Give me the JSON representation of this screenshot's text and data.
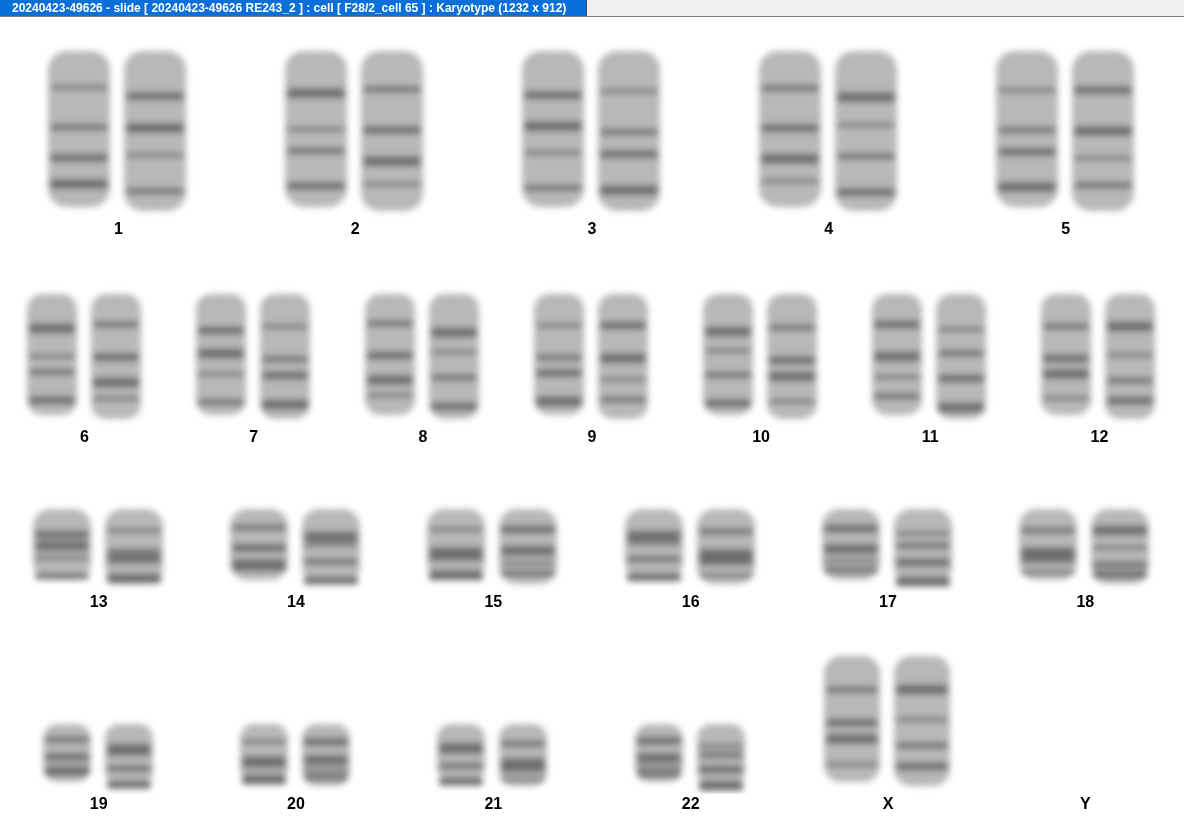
{
  "window": {
    "title": "20240423-49626 - slide [ 20240423-49626 RE243_2 ] : cell [ F28/2_cell 65 ] : Karyotype  (1232 x 912)"
  },
  "karyotype": {
    "rows": [
      {
        "pairs": [
          {
            "label": "1",
            "kind": "pair"
          },
          {
            "label": "2",
            "kind": "pair"
          },
          {
            "label": "3",
            "kind": "pair"
          },
          {
            "label": "4",
            "kind": "pair"
          },
          {
            "label": "5",
            "kind": "pair"
          }
        ]
      },
      {
        "pairs": [
          {
            "label": "6",
            "kind": "pair"
          },
          {
            "label": "7",
            "kind": "pair"
          },
          {
            "label": "8",
            "kind": "pair"
          },
          {
            "label": "9",
            "kind": "pair"
          },
          {
            "label": "10",
            "kind": "pair"
          },
          {
            "label": "11",
            "kind": "pair"
          },
          {
            "label": "12",
            "kind": "pair"
          }
        ]
      },
      {
        "pairs": [
          {
            "label": "13",
            "kind": "pair"
          },
          {
            "label": "14",
            "kind": "pair"
          },
          {
            "label": "15",
            "kind": "pair"
          },
          {
            "label": "16",
            "kind": "pair"
          },
          {
            "label": "17",
            "kind": "pair"
          },
          {
            "label": "18",
            "kind": "pair"
          }
        ]
      },
      {
        "pairs": [
          {
            "label": "19",
            "kind": "pair"
          },
          {
            "label": "20",
            "kind": "pair"
          },
          {
            "label": "21",
            "kind": "pair"
          },
          {
            "label": "22",
            "kind": "pair"
          },
          {
            "label": "X",
            "kind": "large-pair"
          },
          {
            "label": "Y",
            "kind": "empty"
          }
        ]
      }
    ]
  }
}
